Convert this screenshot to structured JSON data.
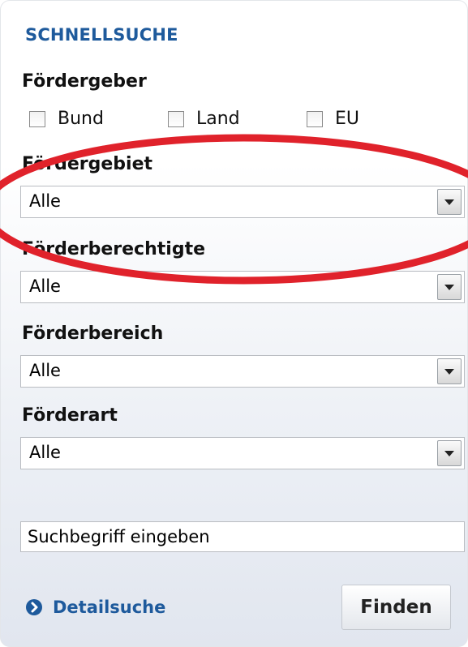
{
  "header": {
    "title": "SCHNELLSUCHE"
  },
  "foerdergeber": {
    "label": "Fördergeber",
    "options": [
      {
        "label": "Bund",
        "checked": false
      },
      {
        "label": "Land",
        "checked": false
      },
      {
        "label": "EU",
        "checked": false
      }
    ]
  },
  "selects": [
    {
      "label": "Fördergebiet",
      "value": "Alle"
    },
    {
      "label": "Förderberechtigte",
      "value": "Alle"
    },
    {
      "label": "Förderbereich",
      "value": "Alle"
    },
    {
      "label": "Förderart",
      "value": "Alle"
    }
  ],
  "search": {
    "value": "Suchbegriff eingeben"
  },
  "footer": {
    "detail_link": "Detailsuche",
    "submit": "Finden"
  },
  "colors": {
    "accent": "#1e5a9c",
    "annotation": "#e0222b"
  },
  "icons": {
    "dropdown": "triangle-down",
    "detail": "circle-arrow-right"
  }
}
